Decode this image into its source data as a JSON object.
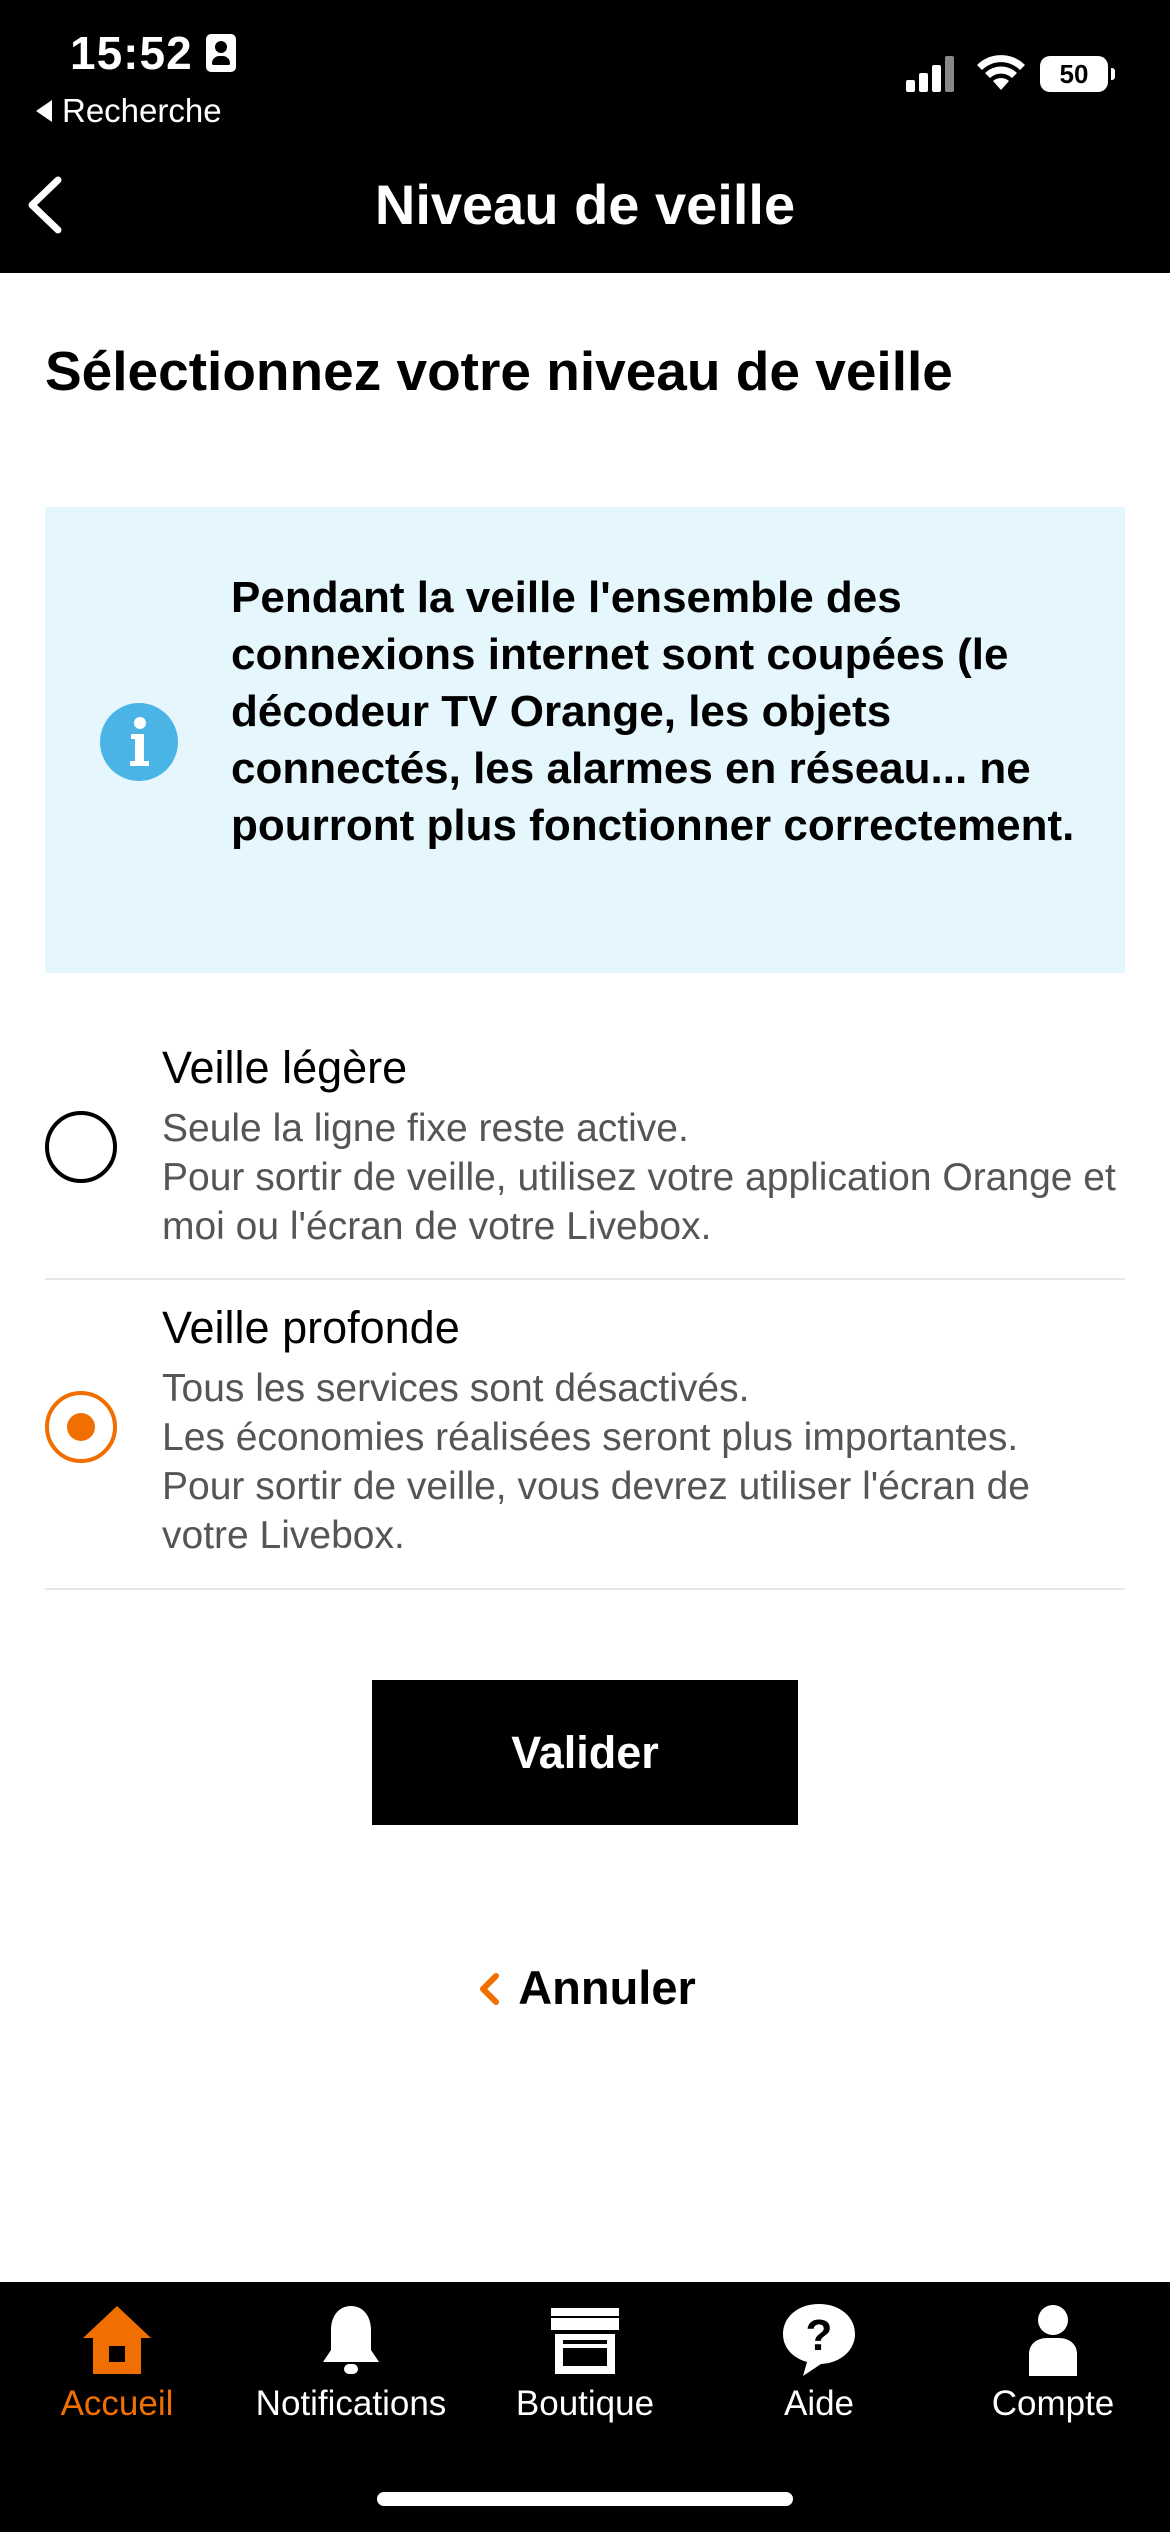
{
  "status_bar": {
    "time": "15:52",
    "back_app_label": "Recherche",
    "battery": "50"
  },
  "header": {
    "title": "Niveau de veille"
  },
  "main": {
    "heading": "Sélectionnez votre niveau de veille",
    "info_text": "Pendant la veille l'ensemble des connexions internet sont coupées (le décodeur TV Orange, les objets connectés, les alarmes en réseau... ne pourront plus fonctionner correctement.",
    "options": [
      {
        "title": "Veille légère",
        "desc": [
          "Seule la ligne fixe reste active.",
          "Pour sortir de veille, utilisez votre application Orange et moi ou l'écran de votre Livebox."
        ],
        "selected": false
      },
      {
        "title": "Veille profonde",
        "desc": [
          "Tous les services sont désactivés.",
          "Les économies réalisées seront plus importantes.",
          "Pour sortir de veille, vous devrez utiliser l'écran de votre Livebox."
        ],
        "selected": true
      }
    ],
    "validate_label": "Valider",
    "cancel_label": "Annuler"
  },
  "tabbar": {
    "items": [
      {
        "label": "Accueil",
        "icon": "home-icon",
        "active": true
      },
      {
        "label": "Notifications",
        "icon": "bell-icon",
        "active": false
      },
      {
        "label": "Boutique",
        "icon": "shop-icon",
        "active": false
      },
      {
        "label": "Aide",
        "icon": "help-icon",
        "active": false
      },
      {
        "label": "Compte",
        "icon": "user-icon",
        "active": false
      }
    ]
  },
  "colors": {
    "accent": "#f16e00",
    "info_bg": "#e6f6fd",
    "info_icon": "#4bb4e6"
  }
}
